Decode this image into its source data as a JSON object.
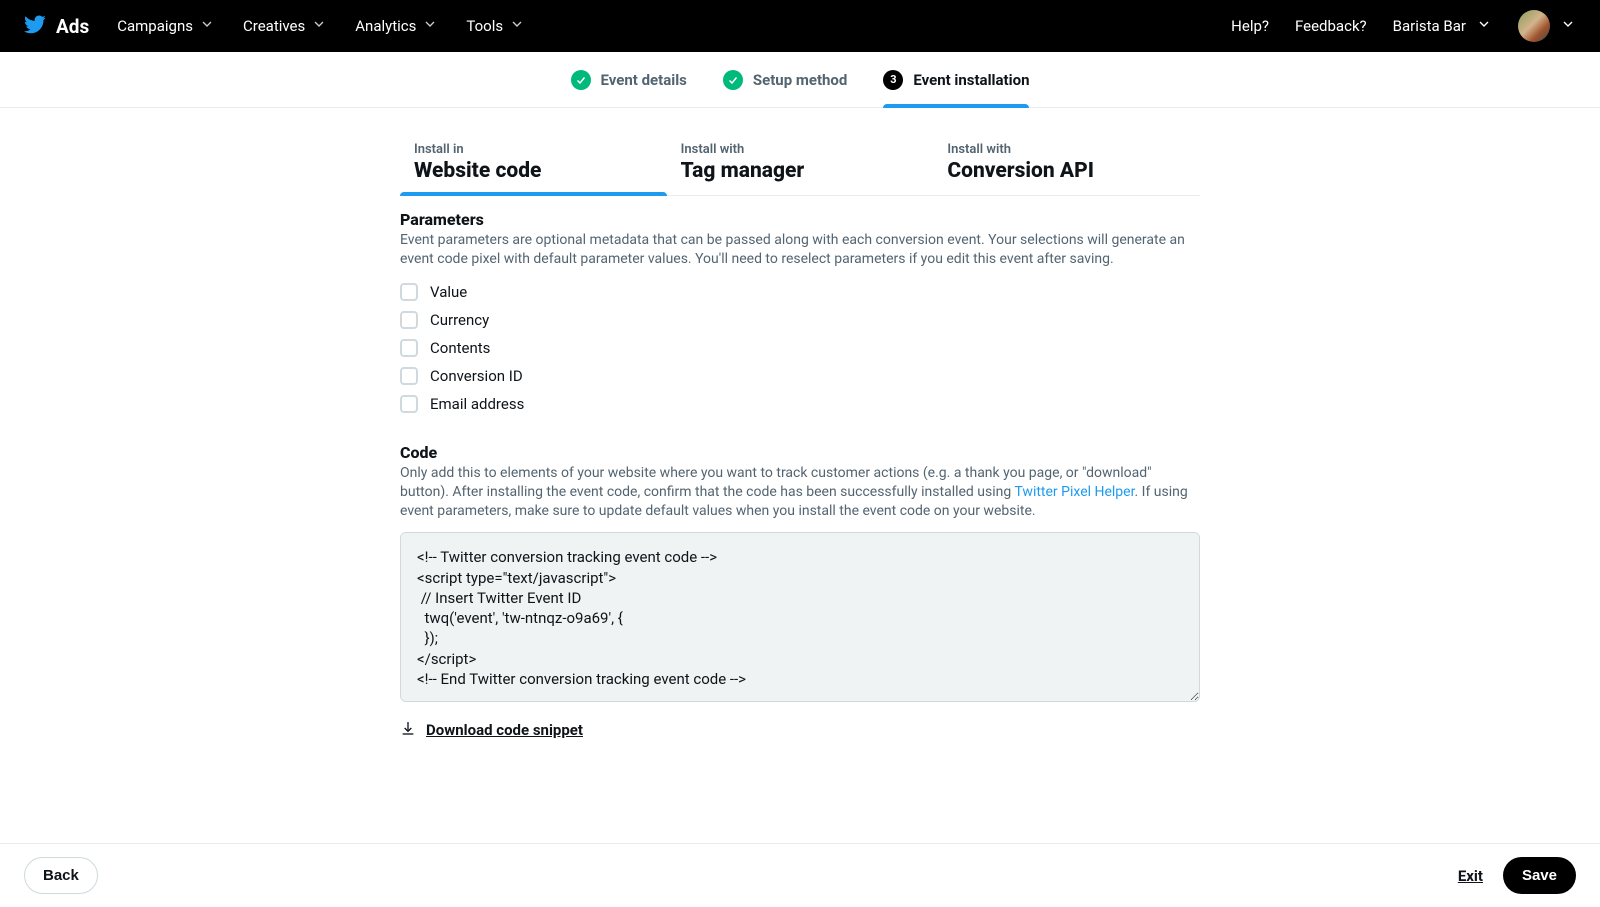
{
  "app": {
    "name": "Ads"
  },
  "nav": {
    "items": [
      "Campaigns",
      "Creatives",
      "Analytics",
      "Tools"
    ],
    "help": "Help?",
    "feedback": "Feedback?",
    "account": "Barista Bar"
  },
  "steps": [
    {
      "label": "Event details",
      "state": "done"
    },
    {
      "label": "Setup method",
      "state": "done"
    },
    {
      "label": "Event installation",
      "state": "active",
      "num": "3"
    }
  ],
  "tabs": [
    {
      "over": "Install in",
      "under": "Website code",
      "active": true
    },
    {
      "over": "Install with",
      "under": "Tag manager",
      "active": false
    },
    {
      "over": "Install with",
      "under": "Conversion API",
      "active": false
    }
  ],
  "params": {
    "title": "Parameters",
    "desc": "Event parameters are optional metadata that can be passed along with each conversion event. Your selections will generate an event code pixel with default parameter values. You'll need to reselect parameters if you edit this event after saving.",
    "items": [
      "Value",
      "Currency",
      "Contents",
      "Conversion ID",
      "Email address"
    ]
  },
  "code": {
    "title": "Code",
    "desc_a": "Only add this to elements of your website where you want to track customer actions (e.g. a thank you page, or \"download\" button). After installing the event code, confirm that the code has been successfully installed using ",
    "desc_link": "Twitter Pixel Helper",
    "desc_b": ". If using event parameters, make sure to update default values when you install the event code on your website.",
    "snippet": "<!-- Twitter conversion tracking event code -->\n<script type=\"text/javascript\">\n // Insert Twitter Event ID\n  twq('event', 'tw-ntnqz-o9a69', {\n  });\n</script>\n<!-- End Twitter conversion tracking event code -->",
    "download": "Download code snippet"
  },
  "footer": {
    "back": "Back",
    "exit": "Exit",
    "save": "Save"
  }
}
